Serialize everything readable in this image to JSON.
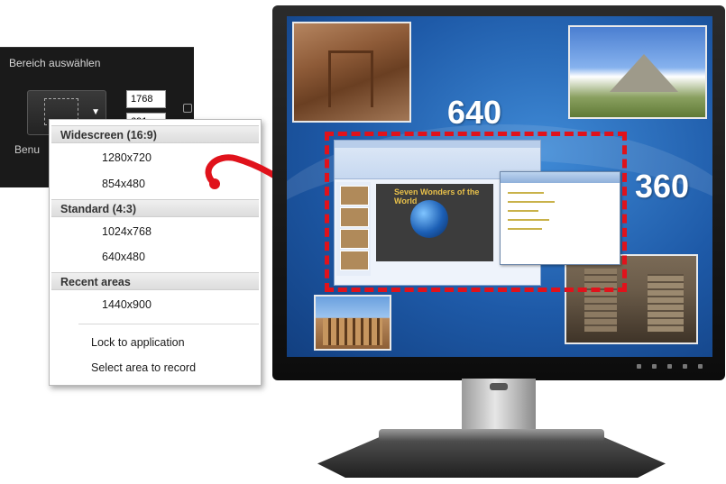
{
  "recorder_panel": {
    "title": "Bereich auswählen",
    "width_value": "1768",
    "height_value": "691",
    "preset_label": "Benu"
  },
  "dropdown": {
    "sections": [
      {
        "header": "Widescreen (16:9)",
        "items": [
          "1280x720",
          "854x480"
        ]
      },
      {
        "header": "Standard (4:3)",
        "items": [
          "1024x768",
          "640x480"
        ]
      },
      {
        "header": "Recent areas",
        "items": [
          "1440x900"
        ]
      }
    ],
    "actions": [
      "Lock to application",
      "Select area to record"
    ]
  },
  "screen": {
    "width_label": "640",
    "height_label": "360",
    "slide_title": "Seven Wonders of the World",
    "capture_color": "#e0121b"
  }
}
